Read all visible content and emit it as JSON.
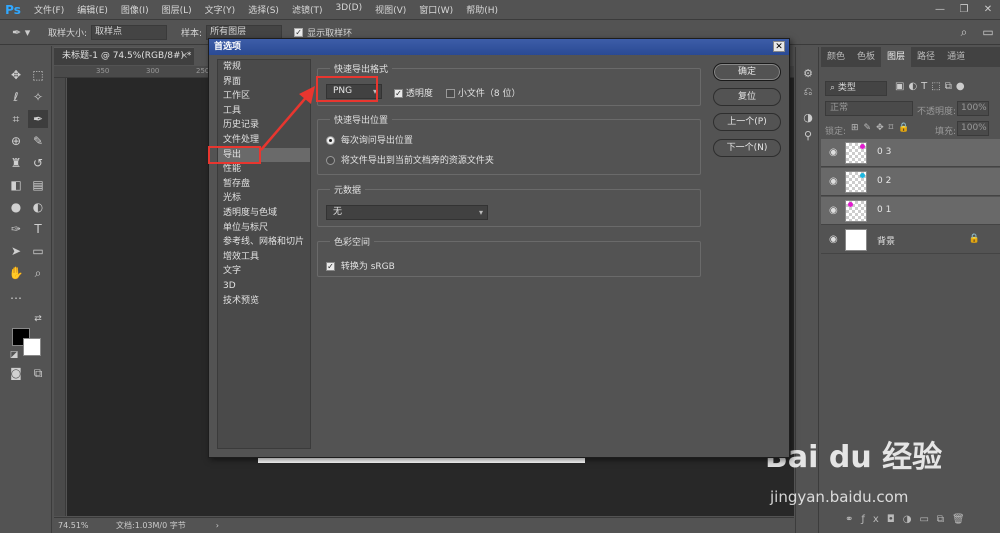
{
  "app": {
    "logo": "Ps",
    "menu": [
      "文件(F)",
      "编辑(E)",
      "图像(I)",
      "图层(L)",
      "文字(Y)",
      "选择(S)",
      "滤镜(T)",
      "3D(D)",
      "视图(V)",
      "窗口(W)",
      "帮助(H)"
    ],
    "window_controls": [
      "—",
      "❐",
      "✕"
    ]
  },
  "options_bar": {
    "sample_size_label": "取样大小:",
    "sample_size_value": "取样点",
    "sample_label": "样本:",
    "sample_value": "所有图层",
    "show_ring_label": "显示取样环"
  },
  "document": {
    "tab_title": "未标题-1 @ 74.5%(RGB/8#) *",
    "ruler_ticks": [
      "350",
      "300",
      "250"
    ],
    "zoom": "74.51%",
    "doc_info": "文档:1.03M/0 字节"
  },
  "dialog": {
    "title": "首选项",
    "categories": [
      "常规",
      "界面",
      "工作区",
      "工具",
      "历史记录",
      "文件处理",
      "导出",
      "性能",
      "暂存盘",
      "光标",
      "透明度与色域",
      "单位与标尺",
      "参考线、网格和切片",
      "增效工具",
      "文字",
      "3D",
      "技术预览"
    ],
    "active_category": "导出",
    "quick_export_format": {
      "legend": "快速导出格式",
      "format": "PNG",
      "transparency_label": "透明度",
      "transparency_checked": true,
      "small_file_label": "小文件（8 位）",
      "small_file_checked": false
    },
    "quick_export_location": {
      "legend": "快速导出位置",
      "option_ask": "每次询问导出位置",
      "option_assets": "将文件导出到当前文档旁的资源文件夹",
      "selected": "option_ask"
    },
    "metadata": {
      "legend": "元数据",
      "value": "无"
    },
    "color_space": {
      "legend": "色彩空间",
      "convert_label": "转换为 sRGB",
      "convert_checked": true
    },
    "buttons": {
      "ok": "确定",
      "reset": "复位",
      "prev": "上一个(P)",
      "next": "下一个(N)"
    }
  },
  "layers_panel": {
    "tabs": [
      "颜色",
      "色板",
      "图层",
      "路径",
      "通道"
    ],
    "active_tab": "图层",
    "filter_kind": "类型",
    "blend_mode": "正常",
    "opacity_label": "不透明度:",
    "opacity_value": "100%",
    "lock_label": "锁定:",
    "fill_label": "填充:",
    "fill_value": "100%",
    "layers": [
      {
        "name": "0 3",
        "selected": true
      },
      {
        "name": "0 2",
        "selected": true
      },
      {
        "name": "0 1",
        "selected": true
      },
      {
        "name": "背景",
        "selected": false
      }
    ]
  },
  "watermark": {
    "brand": "Bai du 经验",
    "url": "jingyan.baidu.com"
  },
  "colors": {
    "annotation_red": "#e8362f",
    "dialog_title_blue": "#2a4a94",
    "ui_gray": "#535353"
  }
}
